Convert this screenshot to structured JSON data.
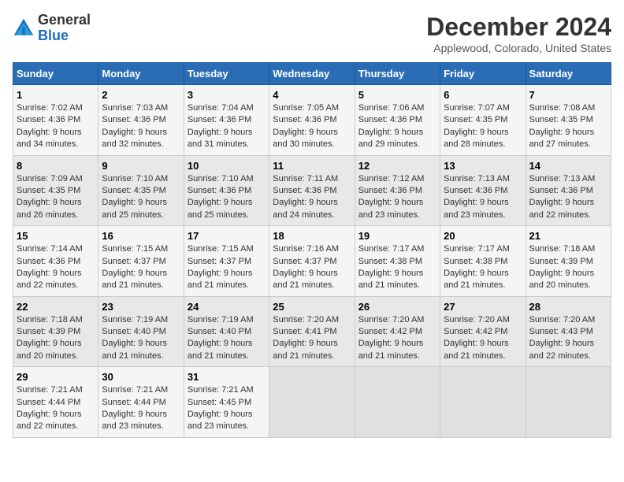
{
  "logo": {
    "line1": "General",
    "line2": "Blue"
  },
  "title": "December 2024",
  "location": "Applewood, Colorado, United States",
  "days_of_week": [
    "Sunday",
    "Monday",
    "Tuesday",
    "Wednesday",
    "Thursday",
    "Friday",
    "Saturday"
  ],
  "weeks": [
    [
      {
        "day": 1,
        "info": "Sunrise: 7:02 AM\nSunset: 4:36 PM\nDaylight: 9 hours\nand 34 minutes."
      },
      {
        "day": 2,
        "info": "Sunrise: 7:03 AM\nSunset: 4:36 PM\nDaylight: 9 hours\nand 32 minutes."
      },
      {
        "day": 3,
        "info": "Sunrise: 7:04 AM\nSunset: 4:36 PM\nDaylight: 9 hours\nand 31 minutes."
      },
      {
        "day": 4,
        "info": "Sunrise: 7:05 AM\nSunset: 4:36 PM\nDaylight: 9 hours\nand 30 minutes."
      },
      {
        "day": 5,
        "info": "Sunrise: 7:06 AM\nSunset: 4:36 PM\nDaylight: 9 hours\nand 29 minutes."
      },
      {
        "day": 6,
        "info": "Sunrise: 7:07 AM\nSunset: 4:35 PM\nDaylight: 9 hours\nand 28 minutes."
      },
      {
        "day": 7,
        "info": "Sunrise: 7:08 AM\nSunset: 4:35 PM\nDaylight: 9 hours\nand 27 minutes."
      }
    ],
    [
      {
        "day": 8,
        "info": "Sunrise: 7:09 AM\nSunset: 4:35 PM\nDaylight: 9 hours\nand 26 minutes."
      },
      {
        "day": 9,
        "info": "Sunrise: 7:10 AM\nSunset: 4:35 PM\nDaylight: 9 hours\nand 25 minutes."
      },
      {
        "day": 10,
        "info": "Sunrise: 7:10 AM\nSunset: 4:36 PM\nDaylight: 9 hours\nand 25 minutes."
      },
      {
        "day": 11,
        "info": "Sunrise: 7:11 AM\nSunset: 4:36 PM\nDaylight: 9 hours\nand 24 minutes."
      },
      {
        "day": 12,
        "info": "Sunrise: 7:12 AM\nSunset: 4:36 PM\nDaylight: 9 hours\nand 23 minutes."
      },
      {
        "day": 13,
        "info": "Sunrise: 7:13 AM\nSunset: 4:36 PM\nDaylight: 9 hours\nand 23 minutes."
      },
      {
        "day": 14,
        "info": "Sunrise: 7:13 AM\nSunset: 4:36 PM\nDaylight: 9 hours\nand 22 minutes."
      }
    ],
    [
      {
        "day": 15,
        "info": "Sunrise: 7:14 AM\nSunset: 4:36 PM\nDaylight: 9 hours\nand 22 minutes."
      },
      {
        "day": 16,
        "info": "Sunrise: 7:15 AM\nSunset: 4:37 PM\nDaylight: 9 hours\nand 21 minutes."
      },
      {
        "day": 17,
        "info": "Sunrise: 7:15 AM\nSunset: 4:37 PM\nDaylight: 9 hours\nand 21 minutes."
      },
      {
        "day": 18,
        "info": "Sunrise: 7:16 AM\nSunset: 4:37 PM\nDaylight: 9 hours\nand 21 minutes."
      },
      {
        "day": 19,
        "info": "Sunrise: 7:17 AM\nSunset: 4:38 PM\nDaylight: 9 hours\nand 21 minutes."
      },
      {
        "day": 20,
        "info": "Sunrise: 7:17 AM\nSunset: 4:38 PM\nDaylight: 9 hours\nand 21 minutes."
      },
      {
        "day": 21,
        "info": "Sunrise: 7:18 AM\nSunset: 4:39 PM\nDaylight: 9 hours\nand 20 minutes."
      }
    ],
    [
      {
        "day": 22,
        "info": "Sunrise: 7:18 AM\nSunset: 4:39 PM\nDaylight: 9 hours\nand 20 minutes."
      },
      {
        "day": 23,
        "info": "Sunrise: 7:19 AM\nSunset: 4:40 PM\nDaylight: 9 hours\nand 21 minutes."
      },
      {
        "day": 24,
        "info": "Sunrise: 7:19 AM\nSunset: 4:40 PM\nDaylight: 9 hours\nand 21 minutes."
      },
      {
        "day": 25,
        "info": "Sunrise: 7:20 AM\nSunset: 4:41 PM\nDaylight: 9 hours\nand 21 minutes."
      },
      {
        "day": 26,
        "info": "Sunrise: 7:20 AM\nSunset: 4:42 PM\nDaylight: 9 hours\nand 21 minutes."
      },
      {
        "day": 27,
        "info": "Sunrise: 7:20 AM\nSunset: 4:42 PM\nDaylight: 9 hours\nand 21 minutes."
      },
      {
        "day": 28,
        "info": "Sunrise: 7:20 AM\nSunset: 4:43 PM\nDaylight: 9 hours\nand 22 minutes."
      }
    ],
    [
      {
        "day": 29,
        "info": "Sunrise: 7:21 AM\nSunset: 4:44 PM\nDaylight: 9 hours\nand 22 minutes."
      },
      {
        "day": 30,
        "info": "Sunrise: 7:21 AM\nSunset: 4:44 PM\nDaylight: 9 hours\nand 23 minutes."
      },
      {
        "day": 31,
        "info": "Sunrise: 7:21 AM\nSunset: 4:45 PM\nDaylight: 9 hours\nand 23 minutes."
      },
      null,
      null,
      null,
      null
    ]
  ]
}
